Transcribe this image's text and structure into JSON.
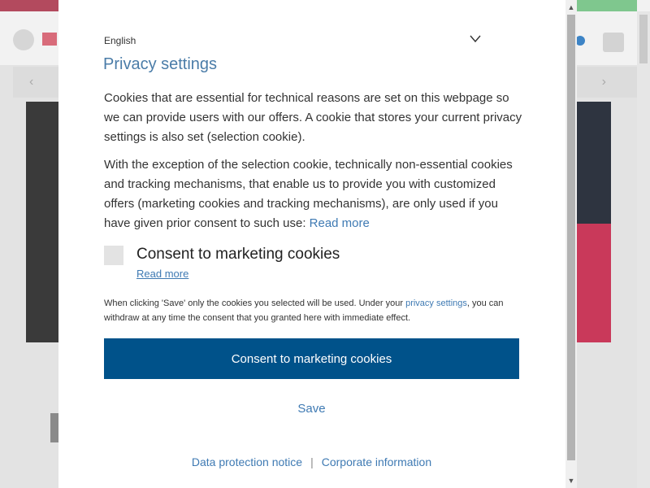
{
  "language": {
    "selected": "English",
    "chevron_icon": "chevron-down-icon"
  },
  "title": "Privacy settings",
  "paragraph1": "Cookies that are essential for technical reasons are set on this webpage so we can provide users with our offers. A cookie that stores your current privacy settings is also set (selection cookie).",
  "paragraph2": "With the exception of the selection cookie, technically non-essential cookies and tracking mechanisms, that enable us to provide you with customized offers (marketing cookies and tracking mechanisms), are only used if you have given prior consent to such use:",
  "paragraph2_link": "Read more",
  "checkbox": {
    "label": "Consent to marketing cookies",
    "read_more": "Read more",
    "checked": false
  },
  "note_pre": "When clicking 'Save' only the cookies you selected will be used. Under your",
  "note_link": "privacy settings",
  "note_post": ", you can withdraw at any time the consent that you granted here with immediate effect.",
  "buttons": {
    "consent": "Consent to marketing cookies",
    "save": "Save"
  },
  "footer": {
    "data_protection": "Data protection notice",
    "separator": "|",
    "corporate": "Corporate information"
  },
  "colors": {
    "primary": "#00528a",
    "link": "#3f7ab3",
    "title": "#4a7ca8"
  }
}
